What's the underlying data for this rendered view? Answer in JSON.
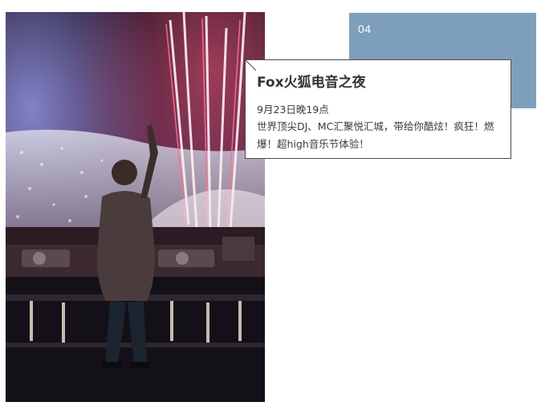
{
  "photo": {
    "subject": "dj-concert-photo"
  },
  "badge": {
    "number": "04",
    "color": "#7e9fbb"
  },
  "event": {
    "title": "Fox火狐电音之夜",
    "date": "9月23日晚19点",
    "description": "世界顶尖DJ、MC汇聚悦汇城，带给你酷炫！疯狂！燃爆！超high音乐节体验！"
  }
}
